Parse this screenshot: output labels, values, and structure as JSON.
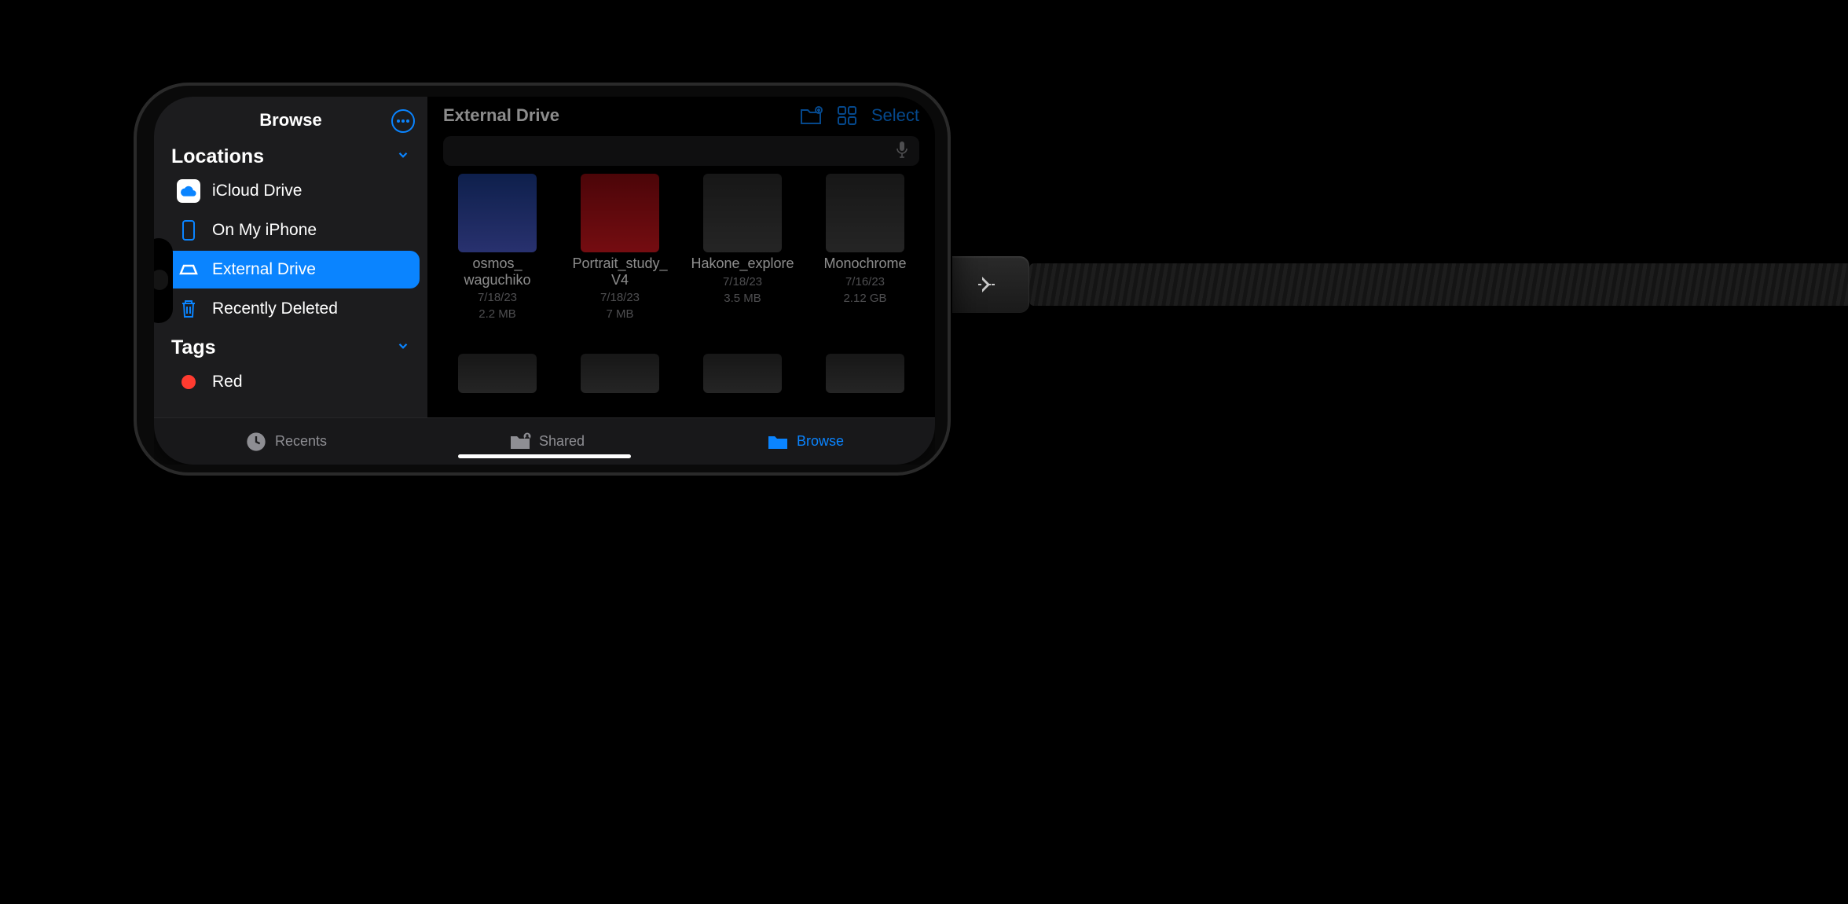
{
  "sidebar": {
    "title": "Browse",
    "sections": {
      "locations": {
        "label": "Locations",
        "items": [
          {
            "label": "iCloud Drive"
          },
          {
            "label": "On My iPhone"
          },
          {
            "label": "External Drive"
          },
          {
            "label": "Recently Deleted"
          }
        ]
      },
      "tags": {
        "label": "Tags",
        "items": [
          {
            "label": "Red"
          }
        ]
      }
    }
  },
  "main": {
    "title": "External Drive",
    "select_label": "Select",
    "files": [
      {
        "name": "osmos_\nwaguchiko",
        "date": "7/18/23",
        "size": "2.2 MB"
      },
      {
        "name": "Portrait_study_\nV4",
        "date": "7/18/23",
        "size": "7 MB"
      },
      {
        "name": "Hakone_explore",
        "date": "7/18/23",
        "size": "3.5 MB"
      },
      {
        "name": "Monochrome",
        "date": "7/16/23",
        "size": "2.12 GB"
      }
    ]
  },
  "tabs": {
    "recents": "Recents",
    "shared": "Shared",
    "browse": "Browse"
  }
}
